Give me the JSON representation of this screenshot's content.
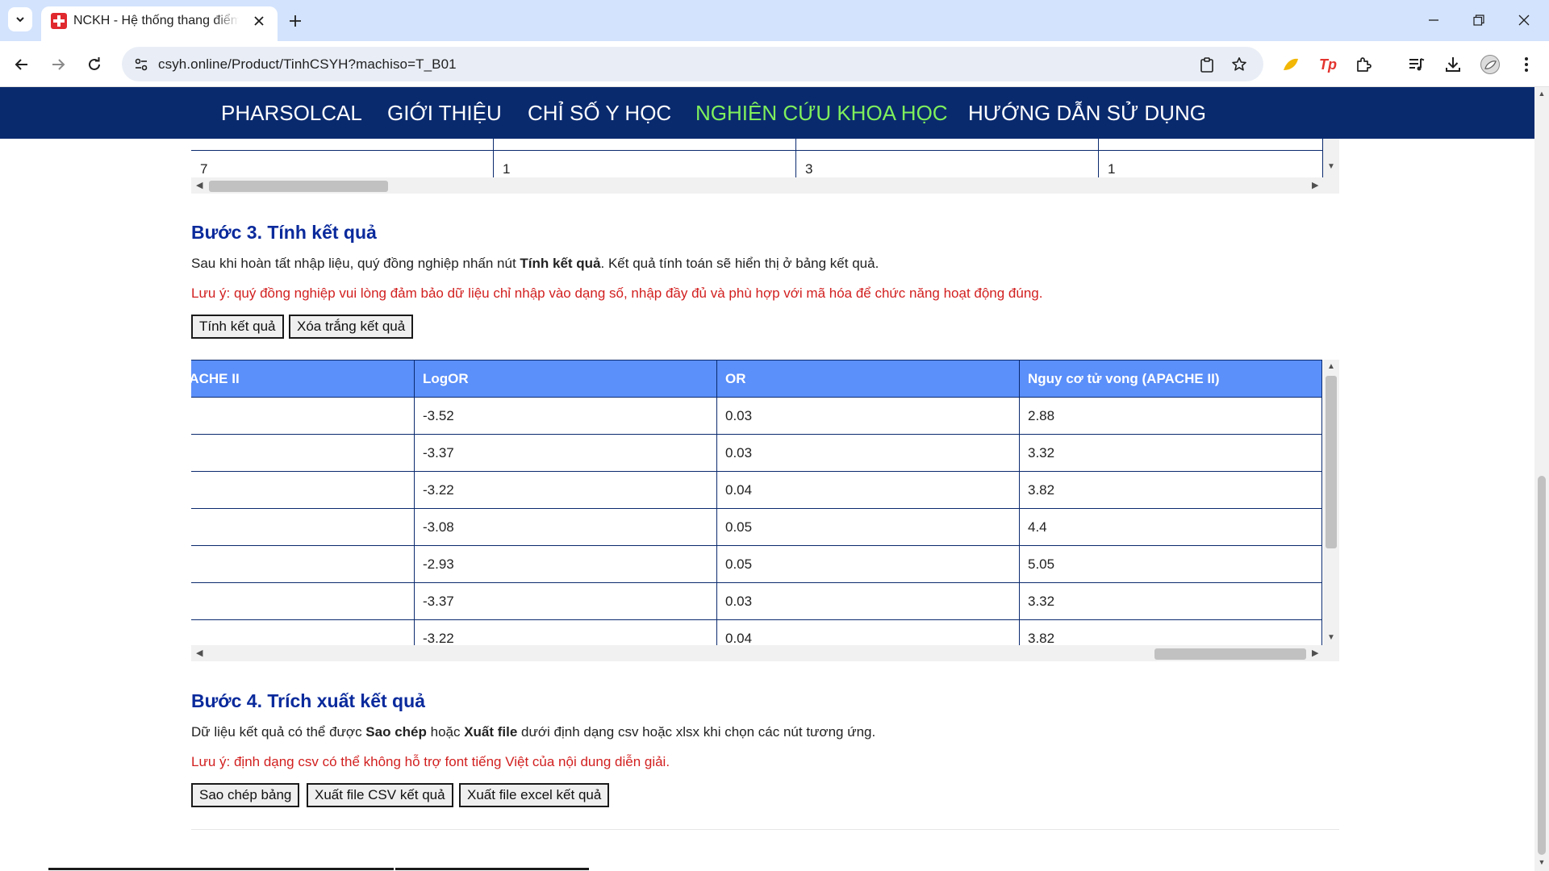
{
  "browser": {
    "tab_title": "NCKH - Hệ thống thang điểm APACHE II",
    "url": "csyh.online/Product/TinhCSYH?machiso=T_B01",
    "colors": {
      "tabstrip": "#d3e3fd",
      "omnibox": "#e9eef6"
    },
    "extension_tp_label": "Tp"
  },
  "nav": {
    "brand": "PHARSOLCAL",
    "items": [
      "GIỚI THIỆU",
      "CHỈ SỐ Y HỌC",
      "NGHIÊN CỨU KHOA HỌC",
      "HƯỚNG DẪN SỬ DỤNG"
    ],
    "active_index": 2,
    "colors": {
      "bar": "#0a2a6e",
      "active": "#7ff05c"
    }
  },
  "input_table_row": [
    "7",
    "1",
    "3",
    "1"
  ],
  "step3": {
    "title": "Bước 3. Tính kết quả",
    "desc_before": "Sau khi hoàn tất nhập liệu, quý đồng nghiệp nhấn nút ",
    "desc_bold": "Tính kết quả",
    "desc_after": ". Kết quả tính toán sẽ hiển thị ở bảng kết quả.",
    "note": "Lưu ý: quý đồng nghiệp vui lòng đảm bảo dữ liệu chỉ nhập vào dạng số, nhập đầy đủ và phù hợp với mã hóa để chức năng hoạt động đúng.",
    "btn_calc": "Tính kết quả",
    "btn_clear": "Xóa trắng kết quả"
  },
  "results": {
    "headers": [
      "APACHE II",
      "LogOR",
      "OR",
      "Nguy cơ tử vong (APACHE II)"
    ],
    "rows": [
      [
        "",
        "-3.52",
        "0.03",
        "2.88"
      ],
      [
        "",
        "-3.37",
        "0.03",
        "3.32"
      ],
      [
        "",
        "-3.22",
        "0.04",
        "3.82"
      ],
      [
        "",
        "-3.08",
        "0.05",
        "4.4"
      ],
      [
        "",
        "-2.93",
        "0.05",
        "5.05"
      ],
      [
        "",
        "-3.37",
        "0.03",
        "3.32"
      ],
      [
        "",
        "-3.22",
        "0.04",
        "3.82"
      ]
    ],
    "colors": {
      "header_bg": "#5b8ff9",
      "border": "#0a2a6e"
    }
  },
  "step4": {
    "title": "Bước 4. Trích xuất kết quả",
    "desc_1": "Dữ liệu kết quả có thể được ",
    "desc_bold_1": "Sao chép",
    "desc_2": " hoặc ",
    "desc_bold_2": "Xuất file",
    "desc_3": " dưới định dạng csv hoặc xlsx khi chọn các nút tương ứng.",
    "note": "Lưu ý: định dạng csv có thể không hỗ trợ font tiếng Việt của nội dung diễn giải.",
    "btn_copy": "Sao chép bảng",
    "btn_csv": "Xuất file CSV kết quả",
    "btn_excel": "Xuất file excel kết quả"
  }
}
